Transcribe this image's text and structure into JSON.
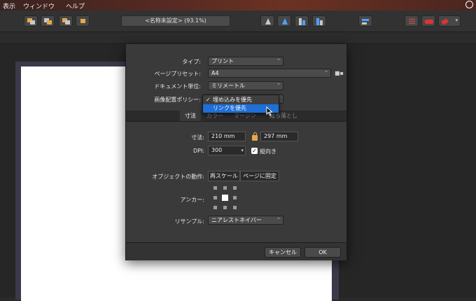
{
  "menubar": {
    "items": [
      "表示",
      "ウィンドウ",
      "ヘルプ"
    ]
  },
  "toolbar": {
    "document_title": "<名称未設定> (93.1%)"
  },
  "dialog": {
    "type_label": "タイプ:",
    "type_value": "プリント",
    "preset_label": "ページプリセット:",
    "preset_value": "A4",
    "unit_label": "ドキュメント単位:",
    "unit_value": "ミリメートル",
    "placement_label": "画像配置ポリシー:",
    "tabs": [
      "寸法",
      "カラー",
      "マージン",
      "裁ち落とし"
    ],
    "size_label": "寸法:",
    "width_value": "210 mm",
    "height_value": "297 mm",
    "dpi_label": "DPI:",
    "dpi_value": "300",
    "orientation_label": "縦向き",
    "object_label": "オブジェクトの動作:",
    "rescale_label": "再スケール",
    "fixed_label": "ページに固定",
    "anchor_label": "アンカー:",
    "resample_label": "リサンプル:",
    "resample_value": "ニアレストネイバー",
    "cancel_label": "キャンセル",
    "ok_label": "OK"
  },
  "popup": {
    "options": [
      "埋め込みを優先",
      "リンクを優先"
    ],
    "checked_index": 0,
    "highlighted_index": 1
  },
  "colors": {
    "accent": "#1f6fd6",
    "lock": "#e6a84a"
  }
}
